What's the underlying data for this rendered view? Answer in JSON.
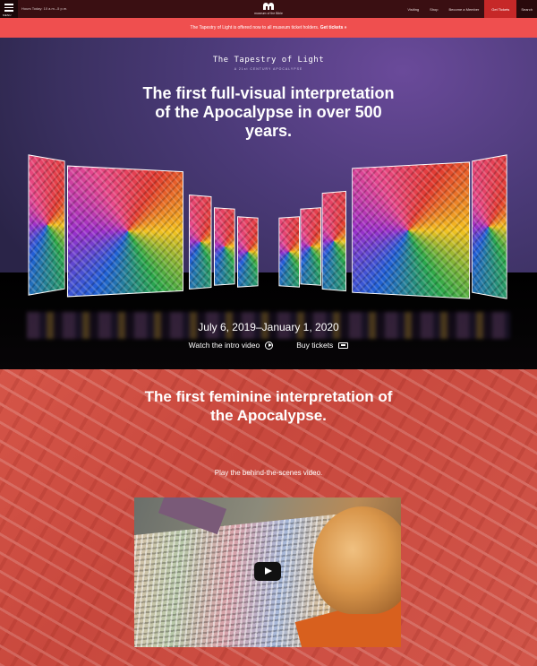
{
  "topbar": {
    "menu_label": "MENU",
    "hours": "Hours Today: 10 a.m.–5 p.m.",
    "logo_text": "museum of the Bible",
    "nav": [
      "Visiting",
      "Shop",
      "Become a Member",
      "Get Tickets",
      "Search"
    ]
  },
  "alert": {
    "text": "The Tapestry of Light is offered now to all museum ticket holders.",
    "cta": "Get tickets »"
  },
  "hero": {
    "brand_title": "The Tapestry of Light",
    "brand_subtitle": "A 21st CENTURY APOCALYPSE",
    "headline": "The first full-visual interpretation of the Apocalypse in over 500 years.",
    "dates": "July 6, 2019–January 1, 2020",
    "watch_label": "Watch the intro video",
    "buy_label": "Buy tickets"
  },
  "section2": {
    "headline": "The first feminine interpretation of the Apocalypse.",
    "subtext": "Play the behind-the-scenes video."
  },
  "colors": {
    "topbar": "#3a0f12",
    "alert": "#ef4f4f",
    "tickets": "#c62828",
    "section2": "#cf4f44"
  }
}
